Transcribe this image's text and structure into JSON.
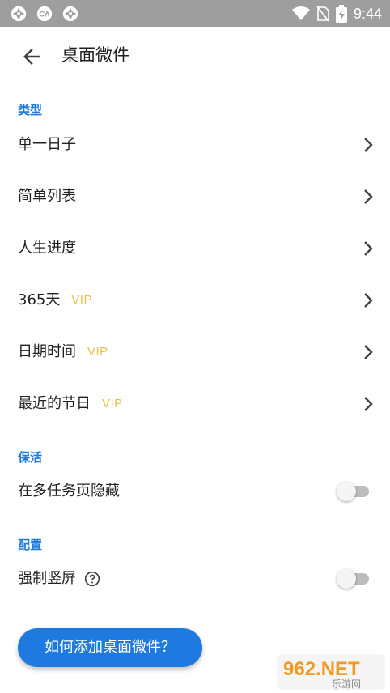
{
  "status_bar": {
    "time": "9:44",
    "left_icons": [
      "aperture-icon",
      "ca-app-icon",
      "aperture-icon"
    ],
    "right_icons": [
      "wifi-icon",
      "no-sim-icon",
      "battery-charging-icon"
    ]
  },
  "toolbar": {
    "title": "桌面微件"
  },
  "sections": {
    "type": {
      "header": "类型",
      "items": [
        {
          "label": "单一日子",
          "badge": ""
        },
        {
          "label": "简单列表",
          "badge": ""
        },
        {
          "label": "人生进度",
          "badge": ""
        },
        {
          "label": "365天",
          "badge": "VIP"
        },
        {
          "label": "日期时间",
          "badge": "VIP"
        },
        {
          "label": "最近的节日",
          "badge": "VIP"
        }
      ]
    },
    "keepalive": {
      "header": "保活",
      "toggle_label": "在多任务页隐藏",
      "toggle_on": false
    },
    "config": {
      "header": "配置",
      "toggle_label": "强制竖屏",
      "toggle_on": false
    }
  },
  "fab": {
    "label": "如何添加桌面微件？"
  },
  "watermark": {
    "logo_text": "962.NET",
    "sub_text": "乐游网"
  },
  "colors": {
    "accent": "#1e7ae0",
    "vip": "#e4c24a",
    "status_bar": "#9e9e9e",
    "text": "#212121"
  }
}
